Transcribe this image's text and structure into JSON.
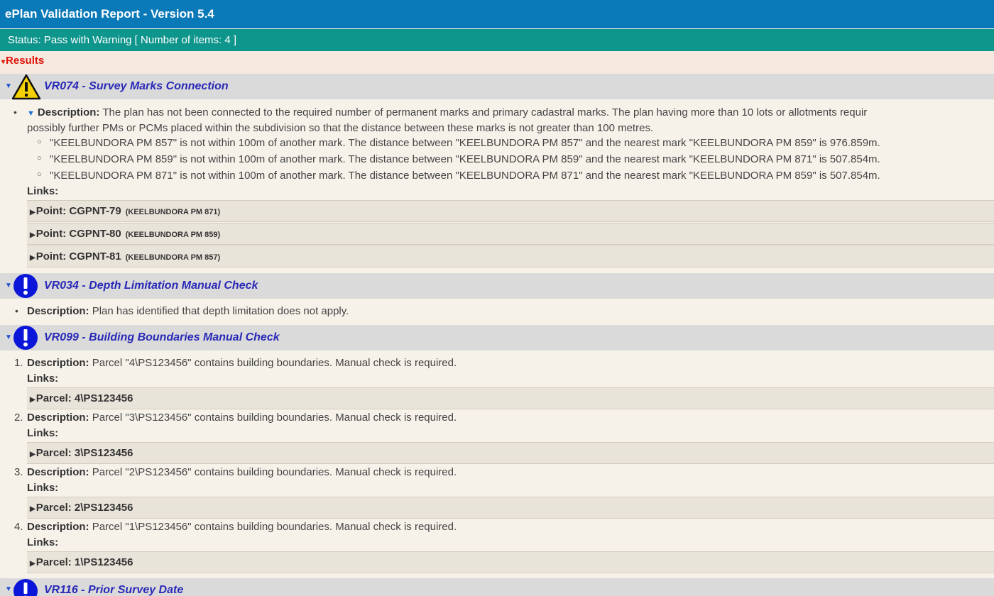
{
  "header": {
    "title": "ePlan Validation Report - Version 5.4"
  },
  "status": {
    "text": "Status: Pass with Warning [ Number of items: 4 ]"
  },
  "results": {
    "label": "Results"
  },
  "rules": [
    {
      "title": "VR074 - Survey Marks Connection",
      "icon": "warning-icon",
      "description_label": "Description:",
      "description_line1": "The plan has not been connected to the required number of permanent marks and primary cadastral marks. The plan having more than 10 lots or allotments requir",
      "description_line2": "possibly further PMs or PCMs placed within the subdivision so that the distance between these marks is not greater than 100 metres.",
      "subitems": [
        "\"KEELBUNDORA PM 857\" is not within 100m of another mark. The distance between \"KEELBUNDORA PM 857\" and the nearest mark \"KEELBUNDORA PM 859\" is 976.859m.",
        "\"KEELBUNDORA PM 859\" is not within 100m of another mark. The distance between \"KEELBUNDORA PM 859\" and the nearest mark \"KEELBUNDORA PM 871\" is 507.854m.",
        "\"KEELBUNDORA PM 871\" is not within 100m of another mark. The distance between \"KEELBUNDORA PM 871\" and the nearest mark \"KEELBUNDORA PM 859\" is 507.854m."
      ],
      "links_label": "Links:",
      "links": [
        {
          "label": "Point: CGPNT-79",
          "sub": "(KEELBUNDORA PM 871)"
        },
        {
          "label": "Point: CGPNT-80",
          "sub": "(KEELBUNDORA PM 859)"
        },
        {
          "label": "Point: CGPNT-81",
          "sub": "(KEELBUNDORA PM 857)"
        }
      ]
    },
    {
      "title": "VR034 - Depth Limitation Manual Check",
      "icon": "info-icon",
      "description_label": "Description:",
      "description": "Plan has identified that depth limitation does not apply."
    },
    {
      "title": "VR099 - Building Boundaries Manual Check",
      "icon": "info-icon",
      "items": [
        {
          "num": "1.",
          "description_label": "Description:",
          "description": "Parcel \"4\\PS123456\" contains building boundaries. Manual check is required.",
          "links_label": "Links:",
          "link": "Parcel: 4\\PS123456"
        },
        {
          "num": "2.",
          "description_label": "Description:",
          "description": "Parcel \"3\\PS123456\" contains building boundaries. Manual check is required.",
          "links_label": "Links:",
          "link": "Parcel: 3\\PS123456"
        },
        {
          "num": "3.",
          "description_label": "Description:",
          "description": "Parcel \"2\\PS123456\" contains building boundaries. Manual check is required.",
          "links_label": "Links:",
          "link": "Parcel: 2\\PS123456"
        },
        {
          "num": "4.",
          "description_label": "Description:",
          "description": "Parcel \"1\\PS123456\" contains building boundaries. Manual check is required.",
          "links_label": "Links:",
          "link": "Parcel: 1\\PS123456"
        }
      ]
    },
    {
      "title": "VR116 - Prior Survey Date",
      "icon": "info-icon"
    }
  ],
  "colors": {
    "header_bg": "#0a79b8",
    "status_bg": "#0e958c",
    "results_text": "#e0140a",
    "rule_title": "#2929b8"
  }
}
